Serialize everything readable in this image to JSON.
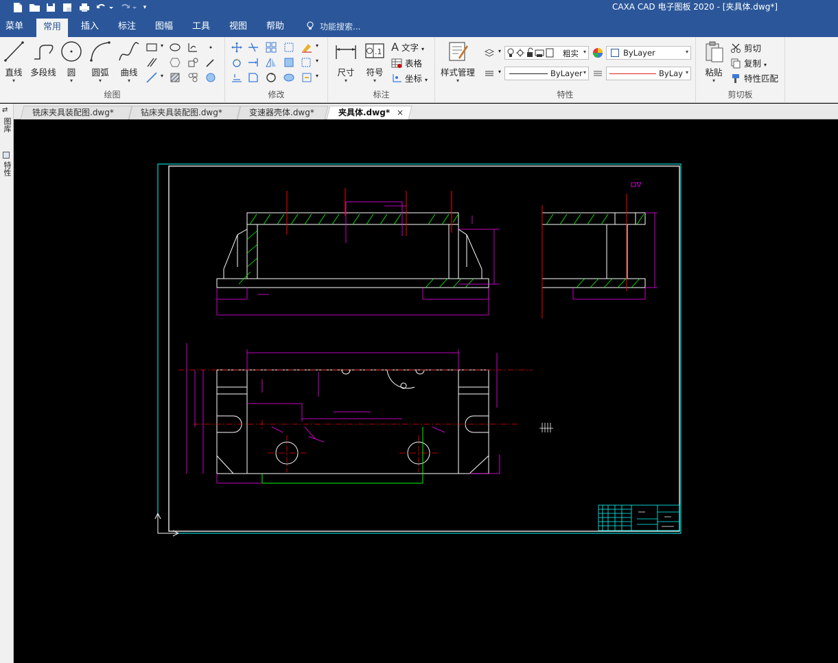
{
  "app": {
    "window_title": "CAXA CAD 电子图板 2020 - [夹具体.dwg*]"
  },
  "quick_access": [
    "new-icon",
    "open-icon",
    "save-icon",
    "save-as-icon",
    "print-icon",
    "undo-icon",
    "redo-icon"
  ],
  "menu": {
    "items": [
      "菜单",
      "常用",
      "插入",
      "标注",
      "图幅",
      "工具",
      "视图",
      "帮助"
    ],
    "active": "常用",
    "search_placeholder": "功能搜索..."
  },
  "ribbon": {
    "draw": {
      "label": "绘图",
      "line": "直线",
      "polyline": "多段线",
      "circle": "圆",
      "arc": "圆弧",
      "curve": "曲线"
    },
    "modify": {
      "label": "修改"
    },
    "annotate": {
      "label": "标注",
      "dimension": "尺寸",
      "symbol": "符号",
      "text": "文字",
      "table": "表格",
      "coordinate": "坐标"
    },
    "properties": {
      "label": "特性",
      "style_manager": "样式管理",
      "layer_name": "粗实",
      "color": "ByLayer",
      "linetype": "ByLayer",
      "lineweight": "ByLay"
    },
    "clipboard": {
      "label": "剪切板",
      "paste": "粘贴",
      "cut": "剪切",
      "copy": "复制",
      "match": "特性匹配"
    }
  },
  "left_panel": {
    "tabs": [
      "图库",
      "特性"
    ]
  },
  "doc_tabs": [
    {
      "name": "铣床夹具装配图.dwg*",
      "active": false
    },
    {
      "name": "钻床夹具装配图.dwg*",
      "active": false
    },
    {
      "name": "变速器壳体.dwg*",
      "active": false
    },
    {
      "name": "夹具体.dwg*",
      "active": true
    }
  ],
  "colors": {
    "title_bar": "#2b579a",
    "ribbon_bg": "#f3f3f3",
    "canvas_bg": "#000000",
    "outline": "#ffffff",
    "dimension": "#ff00ff",
    "centerline": "#ff0000",
    "hatch": "#00ff00",
    "frame": "#00ffff"
  }
}
